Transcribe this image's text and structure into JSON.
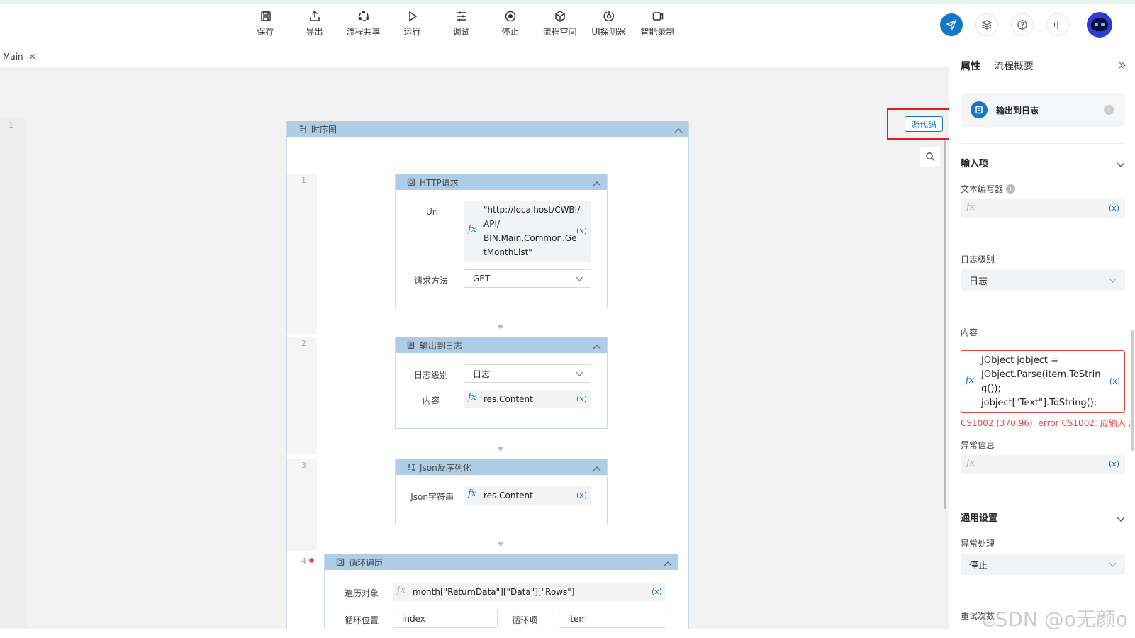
{
  "toolbar": {
    "items": [
      {
        "label": "保存",
        "icon": "save-icon"
      },
      {
        "label": "导出",
        "icon": "export-icon"
      },
      {
        "label": "流程共享",
        "icon": "share-icon"
      },
      {
        "label": "运行",
        "icon": "play-icon"
      },
      {
        "label": "调试",
        "icon": "debug-icon"
      },
      {
        "label": "停止",
        "icon": "stop-icon"
      },
      {
        "label": "流程空间",
        "icon": "cube-icon"
      },
      {
        "label": "UI探测器",
        "icon": "probe-icon"
      },
      {
        "label": "智能录制",
        "icon": "record-icon"
      }
    ]
  },
  "topright": {
    "lang": "中"
  },
  "tabs": [
    {
      "label": "Main"
    }
  ],
  "canvas": {
    "source_code_label": "源代码",
    "sequence": {
      "title": "时序图",
      "line": "1"
    },
    "nodes": [
      {
        "line": "1",
        "title": "HTTP请求",
        "url_label": "Url",
        "url_lines": [
          "\"http://localhost/CWBI/",
          "API/",
          "BIN.Main.Common.Ge",
          "tMonthList\""
        ],
        "method_label": "请求方法",
        "method_value": "GET"
      },
      {
        "line": "2",
        "title": "输出到日志",
        "level_label": "日志级别",
        "level_value": "日志",
        "content_label": "内容",
        "content_value": "res.Content"
      },
      {
        "line": "3",
        "title": "Json反序列化",
        "json_label": "Json字符串",
        "json_value": "res.Content"
      },
      {
        "line": "4",
        "title": "循环遍历",
        "target_label": "遍历对象",
        "target_value": "month[\"ReturnData\"][\"Data\"][\"Rows\"]",
        "index_label": "循环位置",
        "index_value": "index",
        "item_label": "循环项",
        "item_value": "item"
      }
    ],
    "fx_symbol": "fx",
    "var_symbol": "(x)"
  },
  "panel": {
    "tabs": [
      "属性",
      "流程概要"
    ],
    "card_title": "输出到日志",
    "input_section": "输入项",
    "text_editor_label": "文本编写器",
    "log_level_label": "日志级别",
    "log_level_value": "日志",
    "content_label": "内容",
    "content_code": [
      "JObject jobject =",
      "JObject.Parse(item.ToStrin",
      "g());",
      "jobject[\"Text\"].ToString();"
    ],
    "error_text": "CS1002 (370,96): error CS1002: 应输入 ;",
    "exception_label": "异常信息",
    "general_section": "通用设置",
    "exception_handling_label": "异常处理",
    "exception_handling_value": "停止",
    "retry_label": "重试次数",
    "info_glyph": "i",
    "fx_symbol": "fx",
    "var_symbol": "(x)"
  },
  "watermark": "CSDN @o无颜o",
  "colors": {
    "accent": "#1677c9",
    "node_header": "#aecde6",
    "error": "#e04848",
    "highlight": "#e02020"
  }
}
